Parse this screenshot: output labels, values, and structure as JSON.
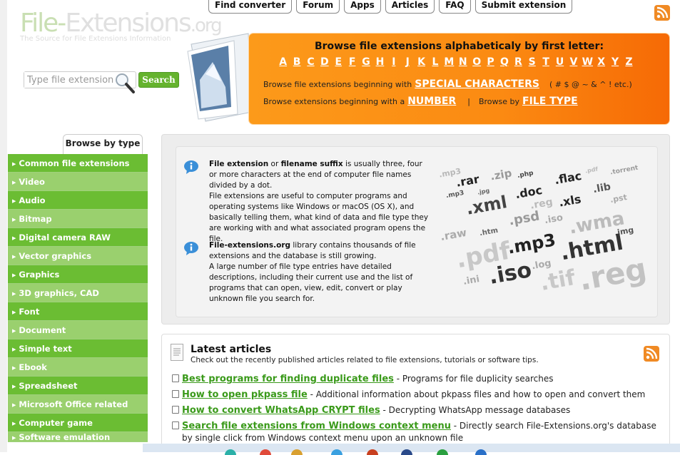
{
  "logo": {
    "text_part1": "File-",
    "text_part2": "Extensions",
    "text_part3": ".org",
    "tagline": "The Source for File Extensions Information"
  },
  "search": {
    "placeholder": "Type file extension",
    "button_label": "Search"
  },
  "topnav": {
    "items": [
      "Find converter",
      "Forum",
      "Apps",
      "Articles",
      "FAQ",
      "Submit extension"
    ]
  },
  "browse": {
    "heading": "Browse file extensions alphabeticaly by first letter:",
    "letters": [
      "A",
      "B",
      "C",
      "D",
      "E",
      "F",
      "G",
      "H",
      "I",
      "J",
      "K",
      "L",
      "M",
      "N",
      "O",
      "P",
      "Q",
      "R",
      "S",
      "T",
      "U",
      "V",
      "W",
      "X",
      "Y",
      "Z"
    ],
    "special_prefix": "Browse file extensions beginning with",
    "special_link": "SPECIAL CHARACTERS",
    "special_symbols": "( # $ @ ~ & ^ ! etc.)",
    "number_prefix": "Browse extensions beginning with a",
    "number_link": "NUMBER",
    "separator": "|",
    "filetype_prefix": "Browse by",
    "filetype_link": "FILE TYPE"
  },
  "sidebar": {
    "tab_label": "Browse by type",
    "categories": [
      "Common file extensions",
      "Video",
      "Audio",
      "Bitmap",
      "Digital camera RAW",
      "Vector graphics",
      "Graphics",
      "3D graphics, CAD",
      "Font",
      "Document",
      "Simple text",
      "Ebook",
      "Spreadsheet",
      "Microsoft Office related",
      "Computer game",
      "Software emulation"
    ]
  },
  "intro": {
    "p1_b1": "File extension",
    "p1_t1": " or ",
    "p1_b2": "filename suffix",
    "p1_t2": " is usually three, four or more characters at the end of computer file names divided by a dot.",
    "p1_t3": "File extensions are useful to computer programs and operating systems like Windows or macOS (OS X), and basically telling them, what kind of data and file type they are working with and what associated program opens the file.",
    "p2_b1": "File-extensions.org",
    "p2_t1": " library contains thousands of file extensions and the database is still growing.",
    "p2_t2": "A large number of file type entries have detailed descriptions, including their current use and the list of programs that can open, view, edit, convert or play unknown file you search for."
  },
  "tag_cloud": [
    ".mp3",
    ".rar",
    ".zip",
    ".php",
    ".flac",
    ".pdf",
    ".torrent",
    ".mp3",
    ".jpg",
    ".doc",
    ".lib",
    ".xml",
    ".reg",
    ".xls",
    ".pst",
    ".psd",
    ".iso",
    ".wma",
    ".raw",
    ".htm",
    ".img",
    ".mp3",
    ".pdf",
    ".html",
    ".log",
    ".ini",
    ".iso",
    ".tif",
    ".reg"
  ],
  "articles": {
    "title": "Latest articles",
    "subtitle": "Check out the recently published articles related to file extensions, tutorials or software tips.",
    "items": [
      {
        "link": "Best programs for finding duplicate files",
        "desc": " - Programs for file duplicity searches"
      },
      {
        "link": "How to open pkpass file",
        "desc": " - Additional information about pkpass files and how to open and convert them"
      },
      {
        "link": "How to convert WhatsApp CRYPT files",
        "desc": " - Decrypting WhatsApp message databases"
      },
      {
        "link": "Search file extensions from Windows context menu",
        "desc": " - Directly search File-Extensions.org's database by single click from Windows context menu upon an unknown file"
      }
    ]
  },
  "colors": {
    "orange": "#fb8a12",
    "green": "#6bbd33",
    "green_light": "#9ad06e",
    "link_green": "#3a9a1a"
  },
  "icons": {
    "rss": "rss-icon",
    "info": "info-icon",
    "magnifier": "magnifier-icon",
    "document": "document-icon"
  }
}
